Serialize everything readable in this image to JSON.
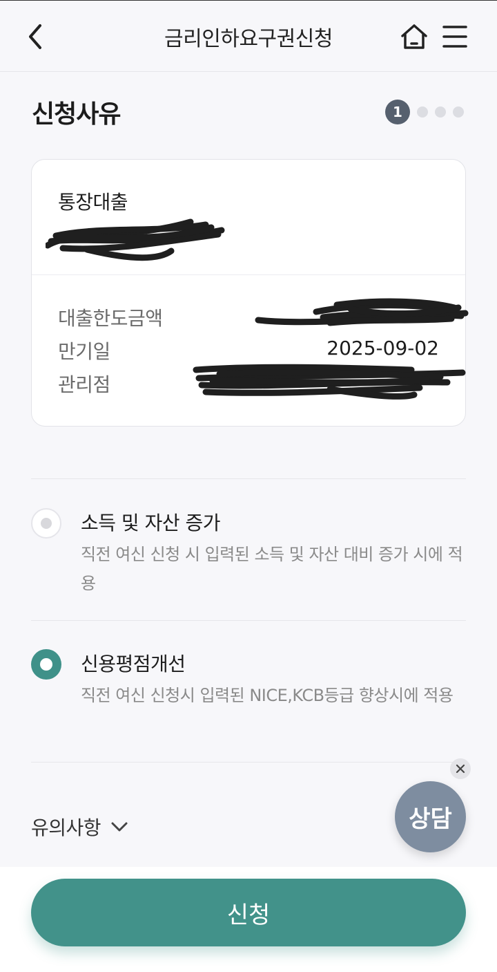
{
  "header": {
    "title": "금리인하요구권신청",
    "back_icon": "chevron-left-icon",
    "home_icon": "home-icon",
    "menu_icon": "hamburger-menu-icon"
  },
  "section": {
    "title": "신청사유",
    "step": {
      "current": "1",
      "total": 4
    }
  },
  "loan_card": {
    "loan_type": "통장대출",
    "details": [
      {
        "label": "대출한도금액",
        "value": ""
      },
      {
        "label": "만기일",
        "value": "2025-09-02"
      },
      {
        "label": "관리점",
        "value": ""
      }
    ]
  },
  "options": [
    {
      "title": "소득 및 자산 증가",
      "description": "직전 여신 신청 시 입력된 소득 및 자산 대비 증가 시에 적용",
      "selected": false
    },
    {
      "title": "신용평점개선",
      "description": "직전 여신 신청시 입력된 NICE,KCB등급 향상시에 적용",
      "selected": true
    }
  ],
  "notice": {
    "label": "유의사항"
  },
  "consult": {
    "label": "상담"
  },
  "apply_button": {
    "label": "신청"
  },
  "colors": {
    "accent": "#42928a",
    "consult": "#7e8da0",
    "step_active": "#56606e"
  }
}
